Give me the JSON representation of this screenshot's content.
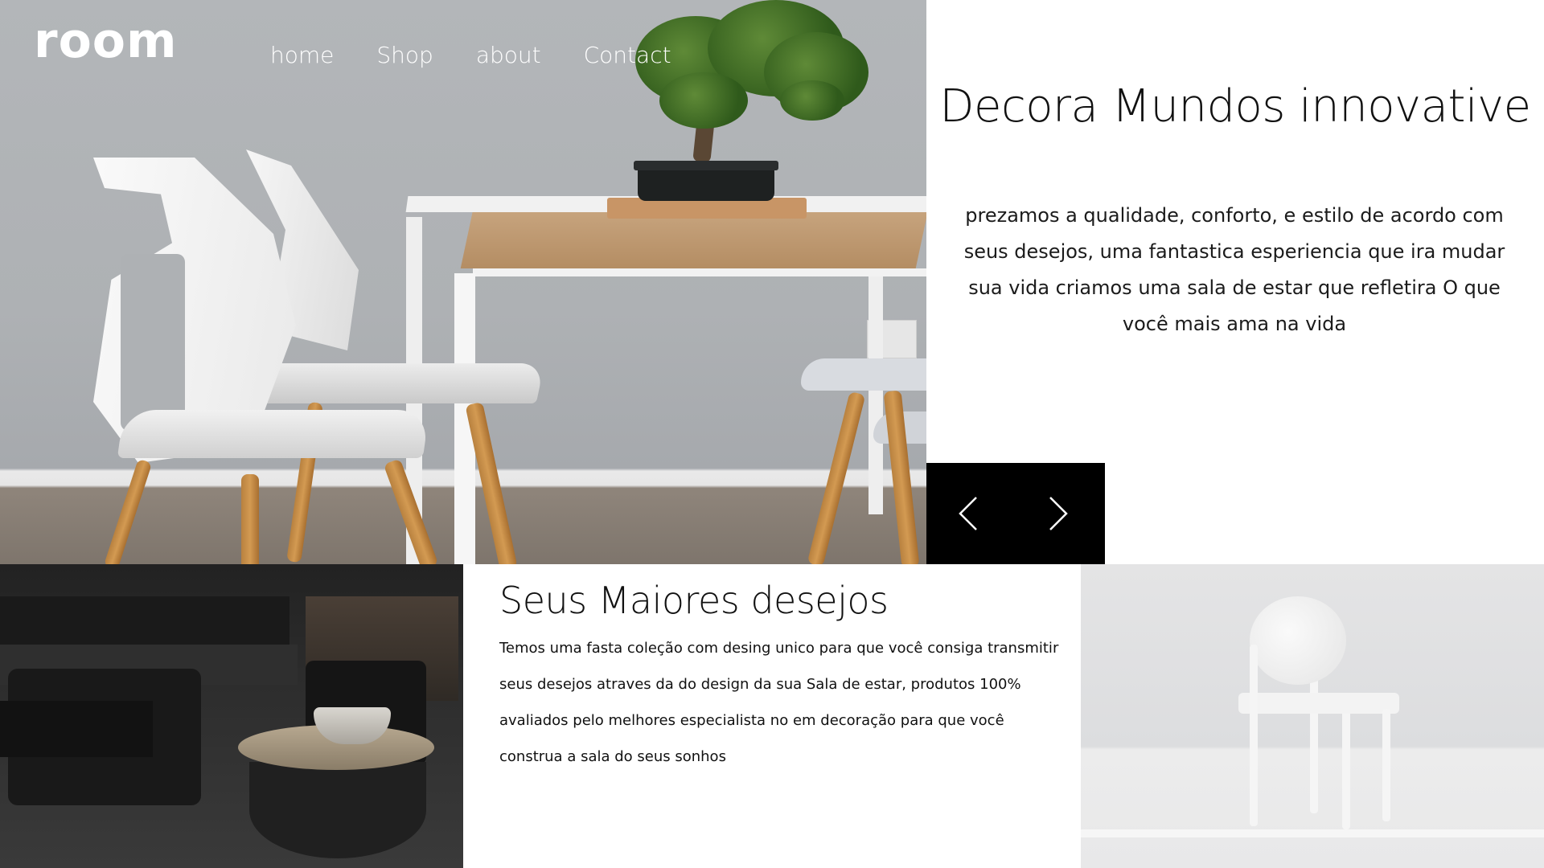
{
  "nav": {
    "logo": "room",
    "links": [
      "home",
      "Shop",
      "about",
      "Contact"
    ]
  },
  "hero": {
    "title": "Decora Mundos innovative",
    "text": "prezamos a qualidade, conforto, e estilo de acordo com seus desejos, uma fantastica esperiencia que ira mudar sua vida criamos uma sala de estar que refletira O que você mais ama na vida"
  },
  "slider": {
    "prev_icon": "chevron-left-icon",
    "next_icon": "chevron-right-icon"
  },
  "section2": {
    "title": "Seus Maiores desejos",
    "text": "Temos uma fasta coleção com desing unico para que você consiga transmitir seus desejos atraves da do design da sua Sala de estar, produtos 100% avaliados pelo melhores especialista no em decoração para que você construa a sala do seus sonhos"
  },
  "colors": {
    "slider_bg": "#000000",
    "text": "#111111",
    "nav_text": "#ffffff"
  }
}
